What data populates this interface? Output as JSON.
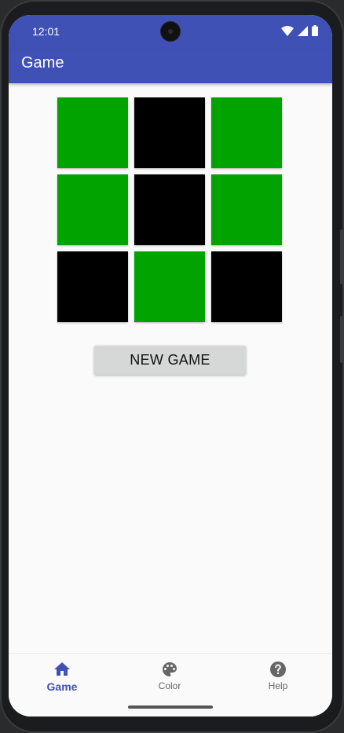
{
  "status_bar": {
    "time": "12:01",
    "icons": [
      "wifi-icon",
      "signal-icon",
      "battery-icon"
    ]
  },
  "app_bar": {
    "title": "Game",
    "color": "#3f51b5"
  },
  "board": {
    "rows": 3,
    "cols": 3,
    "colors": {
      "green": "#00a300",
      "black": "#000000"
    },
    "cells": [
      "green",
      "black",
      "green",
      "green",
      "black",
      "green",
      "black",
      "green",
      "black"
    ]
  },
  "new_game_button": {
    "label": "NEW GAME"
  },
  "bottom_nav": {
    "items": [
      {
        "label": "Game",
        "icon": "home-icon",
        "active": true
      },
      {
        "label": "Color",
        "icon": "palette-icon",
        "active": false
      },
      {
        "label": "Help",
        "icon": "help-icon",
        "active": false
      }
    ]
  }
}
